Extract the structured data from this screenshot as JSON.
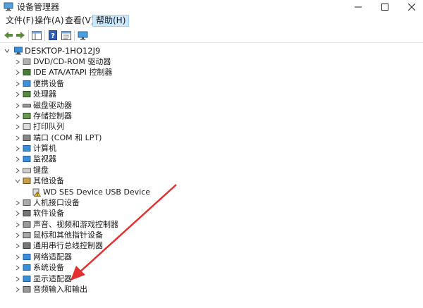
{
  "window": {
    "title": "设备管理器",
    "controls": {
      "minimize": "—",
      "maximize": "☐",
      "close": "✕"
    }
  },
  "menu": [
    {
      "label": "文件(F)",
      "active": false
    },
    {
      "label": "操作(A)",
      "active": false
    },
    {
      "label": "查看(V)",
      "active": false
    },
    {
      "label": "帮助(H)",
      "active": true
    }
  ],
  "tree": {
    "root": "DESKTOP-1HO12J9",
    "items": [
      {
        "label": "DVD/CD-ROM 驱动器",
        "icon": "dvd-icon"
      },
      {
        "label": "IDE ATA/ATAPI 控制器",
        "icon": "ide-controller-icon"
      },
      {
        "label": "便携设备",
        "icon": "portable-device-icon"
      },
      {
        "label": "处理器",
        "icon": "processor-icon"
      },
      {
        "label": "磁盘驱动器",
        "icon": "disk-drive-icon"
      },
      {
        "label": "存储控制器",
        "icon": "storage-controller-icon"
      },
      {
        "label": "打印队列",
        "icon": "printer-icon"
      },
      {
        "label": "端口 (COM 和 LPT)",
        "icon": "port-icon"
      },
      {
        "label": "计算机",
        "icon": "computer-icon"
      },
      {
        "label": "监视器",
        "icon": "monitor-icon"
      },
      {
        "label": "键盘",
        "icon": "keyboard-icon"
      },
      {
        "label": "其他设备",
        "icon": "other-devices-icon",
        "expanded": true
      },
      {
        "label": "WD SES Device USB Device",
        "icon": "unknown-device-warning-icon",
        "child": true
      },
      {
        "label": "人机接口设备",
        "icon": "hid-icon"
      },
      {
        "label": "软件设备",
        "icon": "software-device-icon"
      },
      {
        "label": "声音、视频和游戏控制器",
        "icon": "sound-icon"
      },
      {
        "label": "鼠标和其他指针设备",
        "icon": "mouse-icon"
      },
      {
        "label": "通用串行总线控制器",
        "icon": "usb-controller-icon"
      },
      {
        "label": "网络适配器",
        "icon": "network-adapter-icon"
      },
      {
        "label": "系统设备",
        "icon": "system-device-icon"
      },
      {
        "label": "显示适配器",
        "icon": "display-adapter-icon"
      },
      {
        "label": "音频输入和输出",
        "icon": "audio-io-icon"
      }
    ]
  },
  "colors": {
    "annotation_arrow": "#e03030",
    "menu_active_bg": "#cce8ff"
  }
}
